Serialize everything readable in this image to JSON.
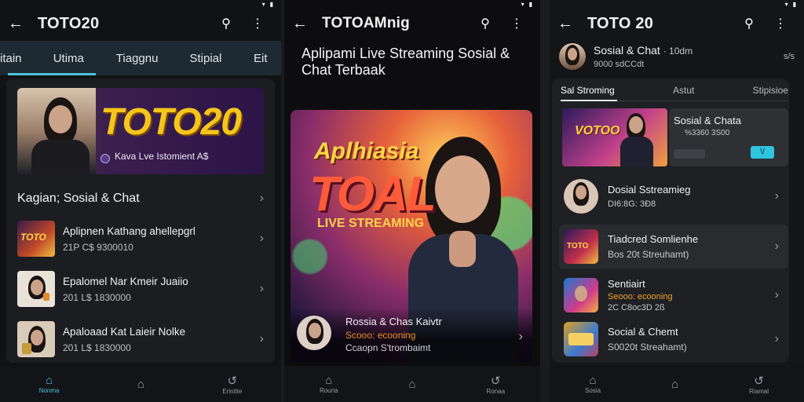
{
  "screen1": {
    "title": "TOTO20",
    "back_icon": "arrow-left-icon",
    "tabs": [
      "itain",
      "Utima",
      "Tiaggnu",
      "Stipial",
      "Eit"
    ],
    "hero": {
      "brand": "TOTO20",
      "subtitle": "Kava Lve Istomient A$"
    },
    "section_title": "Kagian; Sosial & Chat",
    "rows": [
      {
        "title": "Aplipnen Kathang ahellepgrl",
        "subtitle": "21P C$ 9300010"
      },
      {
        "title": "Epalomel Nar Kmeir Juaiio",
        "subtitle": "201 L$ 1830000"
      },
      {
        "title": "Apaloaad Kat Laieir Nolke",
        "subtitle": "201 L$ 1830000"
      }
    ],
    "nav": [
      "Nonma",
      "",
      "Erinitte"
    ]
  },
  "screen2": {
    "title": "TOTOAMnig",
    "heading": "Aplipami Live Streaming Sosial & Chat Terbaak",
    "hero": {
      "line1": "Aplhiasia",
      "line2": "TOAL",
      "line3": "LIVE STREAMING",
      "caption_title": "Rossia & Chas Kaivtr",
      "caption_sub": "Scooo: ecooning",
      "caption_meta": "Ccaopn S'trombaimt"
    },
    "nav": [
      "Rouria",
      "",
      "Ronaa"
    ]
  },
  "screen3": {
    "title": "TOTO 20",
    "profile": {
      "name": "Sosial & Chat",
      "sub": "· 10dm",
      "meta": "9000 sdCCdt",
      "right": "s/s"
    },
    "tabs": [
      "Sal Stroming",
      "Astut",
      "Stipisioe"
    ],
    "feature": {
      "title": "Sosial & Chata",
      "meta": "%3360 3S00",
      "badge": "VOTOO",
      "button_label": "\\/"
    },
    "rows": [
      {
        "title": "Dosial Sstreamieg",
        "subtitle": "DI6:8G: 3Ð8"
      },
      {
        "title": "Tiadcred Somlienhe",
        "subtitle": "Bos 20t Streuhamt)"
      },
      {
        "title": "Sentiairt",
        "subtitle": "Seooo: ecooning",
        "meta": "2C C8oc3D 2ß"
      },
      {
        "title": "Social & Chemt",
        "subtitle": "S0020t Streahamt)"
      }
    ],
    "nav": [
      "Sosia",
      "",
      "Riamal"
    ]
  },
  "colors": {
    "accent": "#4cc2d6",
    "gold": "#f5c51c"
  }
}
